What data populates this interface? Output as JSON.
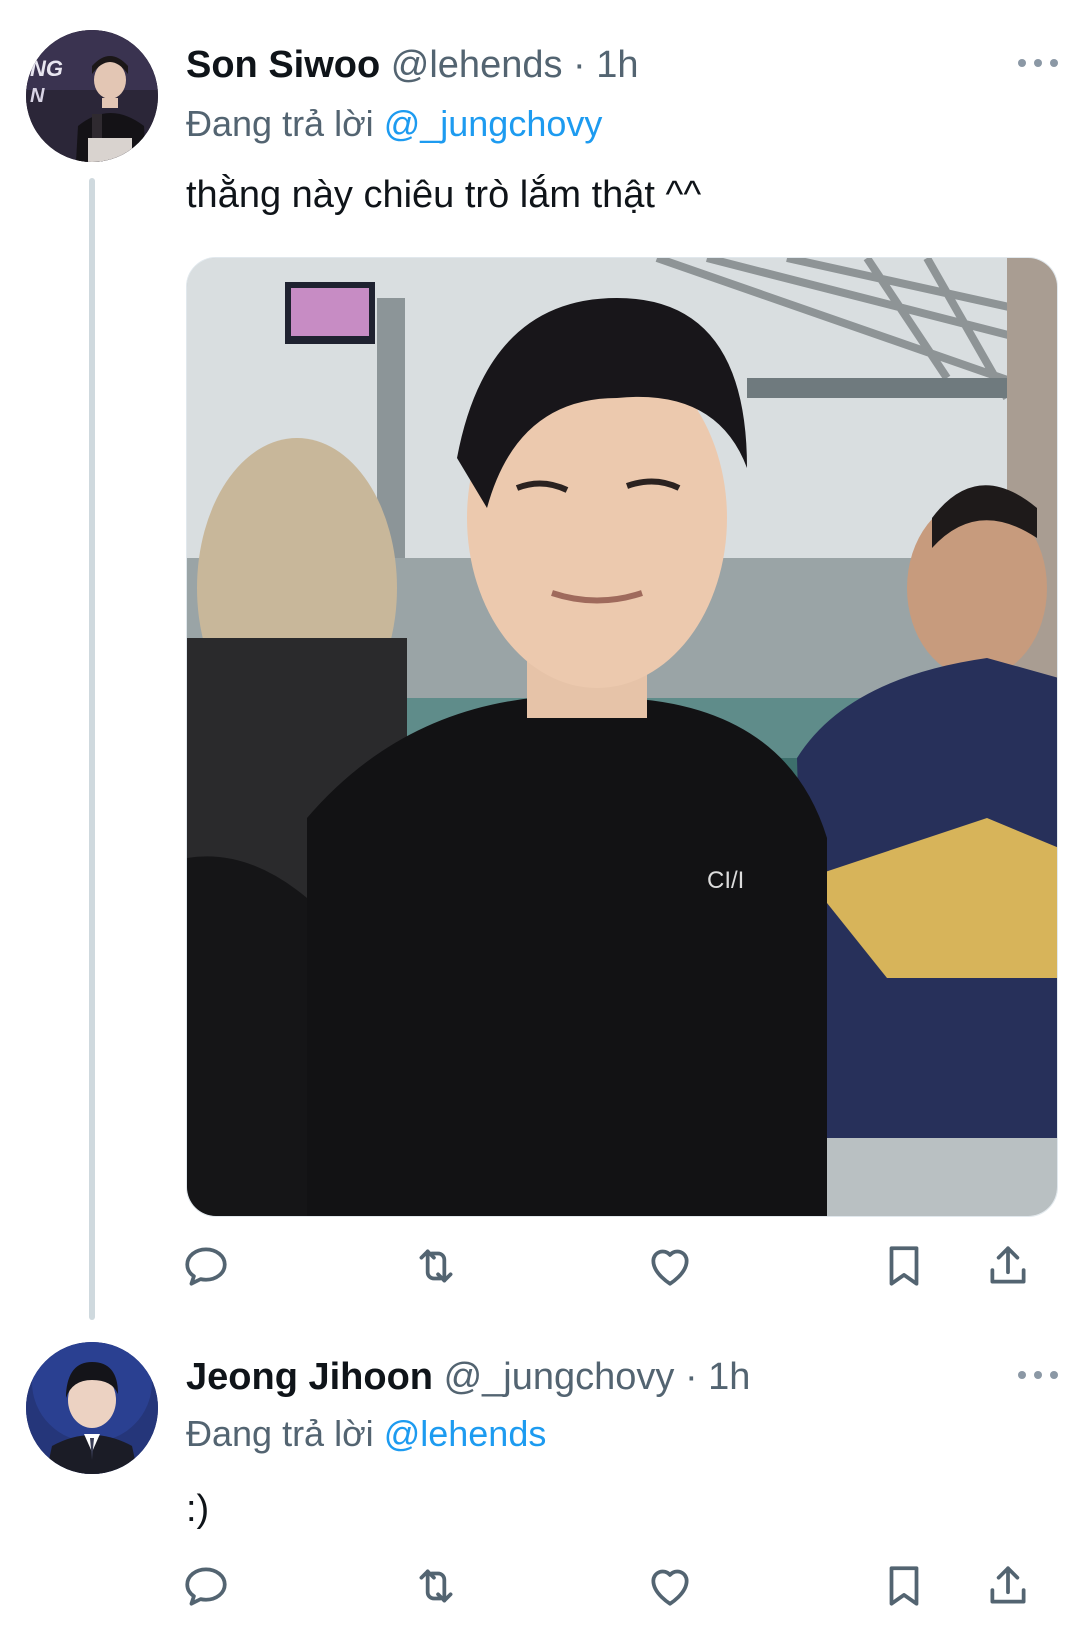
{
  "tweets": [
    {
      "display_name": "Son Siwoo",
      "handle": "@lehends",
      "separator": "·",
      "time": "1h",
      "reply_prefix": "Đang trả lời",
      "reply_mention": "@_jungchovy",
      "text": "thằng này chiêu trò lắm thật ^^",
      "avatar_badge": "NG",
      "has_media": true
    },
    {
      "display_name": "Jeong Jihoon",
      "handle": "@_jungchovy",
      "separator": "·",
      "time": "1h",
      "reply_prefix": "Đang trả lời",
      "reply_mention": "@lehends",
      "text": ":)",
      "has_media": false
    }
  ],
  "icons": {
    "reply": "reply-icon",
    "retweet": "retweet-icon",
    "like": "heart-icon",
    "bookmark": "bookmark-icon",
    "share": "share-icon",
    "more": "more-icon"
  },
  "colors": {
    "link": "#1d9bf0",
    "secondary_text": "#536471",
    "icon": "#536471",
    "thread_line": "#cfd9de"
  }
}
